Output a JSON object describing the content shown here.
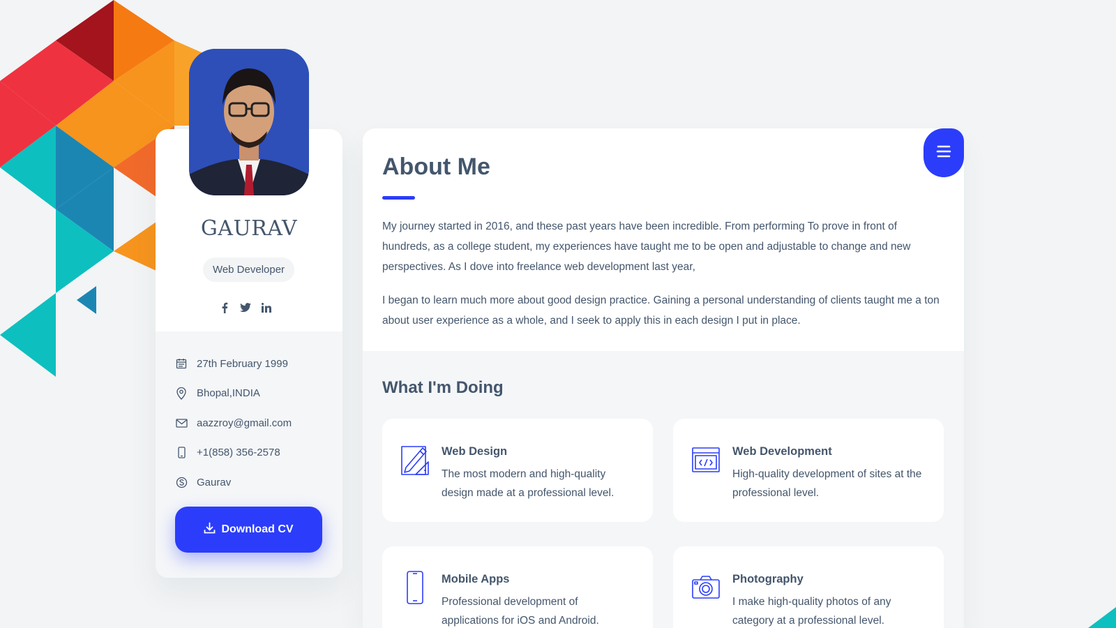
{
  "profile": {
    "name": "GAURAV",
    "role": "Web Developer",
    "socials": [
      {
        "icon": "facebook-icon",
        "glyph": "f"
      },
      {
        "icon": "twitter-icon",
        "glyph": "t"
      },
      {
        "icon": "linkedin-icon",
        "glyph": "in"
      }
    ],
    "info": {
      "birthday": "27th February 1999",
      "location": "Bhopal,INDIA",
      "email": "aazzroy@gmail.com",
      "phone": "+1(858) 356-2578",
      "skype": "Gaurav"
    },
    "download_label": "Download CV"
  },
  "about": {
    "title": "About Me",
    "paragraph1": "My journey started in 2016, and these past years have been incredible. From performing To prove in front of hundreds, as a college student, my experiences have taught me to be open and adjustable to change and new perspectives. As I dove into freelance web development last year,",
    "paragraph2": "I began to learn much more about good design practice. Gaining a personal understanding of clients taught me a ton about user experience as a whole, and I seek to apply this in each design I put in place."
  },
  "doing": {
    "title": "What I'm Doing",
    "services": [
      {
        "title": "Web Design",
        "desc": "The most modern and high-quality design made at a professional level.",
        "icon": "web-design-icon"
      },
      {
        "title": "Web Development",
        "desc": "High-quality development of sites at the professional level.",
        "icon": "web-development-icon"
      },
      {
        "title": "Mobile Apps",
        "desc": "Professional development of applications for iOS and Android.",
        "icon": "mobile-apps-icon"
      },
      {
        "title": "Photography",
        "desc": "I make high-quality photos of any category at a professional level.",
        "icon": "photography-icon"
      }
    ]
  },
  "colors": {
    "accent": "#2b3dfa",
    "text": "#44566c",
    "background": "#f2f4f5"
  }
}
